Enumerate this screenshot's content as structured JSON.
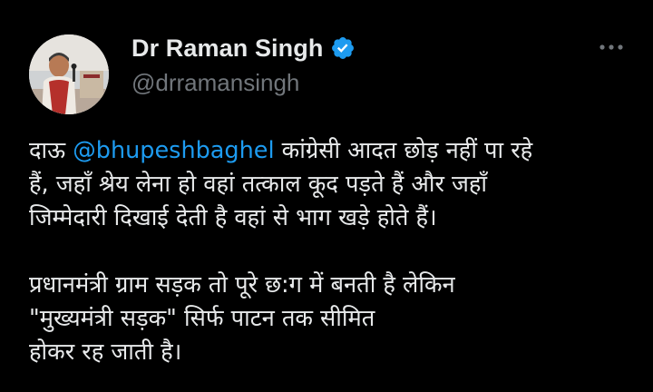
{
  "author": {
    "display_name": "Dr Raman Singh",
    "handle": "@drramansingh",
    "verified": true,
    "verified_icon": "verified-badge-icon",
    "verified_color": "#1d9bf0"
  },
  "menu": {
    "icon": "more-horizontal-icon"
  },
  "tweet": {
    "para1_prefix": "दाऊ ",
    "mention": "@bhupeshbaghel",
    "para1_line1_rest": " कांग्रेसी आदत छोड़ नहीं पा रहे",
    "para1_line2": "हैं, जहाँ श्रेय लेना हो वहां तत्काल कूद पड़ते हैं और जहाँ",
    "para1_line3": "जिम्मेदारी दिखाई देती है वहां से भाग खड़े होते हैं।",
    "para2_line1": "प्रधानमंत्री ग्राम सड़क तो पूरे छ:ग में बनती है लेकिन",
    "para2_line2": "\"मुख्यमंत्री सड़क\" सिर्फ पाटन तक सीमित",
    "para2_line3": "होकर रह जाती है।"
  },
  "colors": {
    "background": "#000000",
    "text": "#e7e9ea",
    "secondary": "#71767b",
    "accent": "#1d9bf0"
  }
}
